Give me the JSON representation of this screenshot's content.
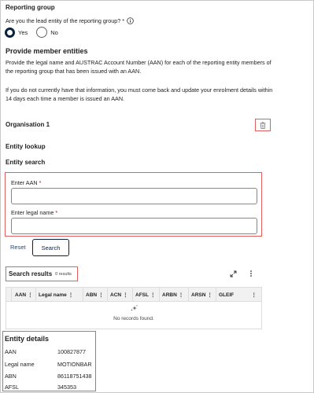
{
  "reporting_group": {
    "title": "Reporting group",
    "question": "Are you the lead entity of the reporting group?",
    "required_mark": "*",
    "info_icon": "info-circle-icon",
    "options": [
      {
        "label": "Yes",
        "selected": true
      },
      {
        "label": "No",
        "selected": false
      }
    ]
  },
  "member_entities": {
    "title": "Provide member entities",
    "para1": "Provide the legal name and AUSTRAC Account Number (AAN) for each of the reporting entity members of the reporting group that has been issued with an AAN.",
    "para2": "If you do not currently have that information, you must come back and update your enrolment details within 14 days each time a member is issued an AAN."
  },
  "organisation": {
    "title": "Organisation 1",
    "delete_icon": "trash-icon"
  },
  "entity_lookup": {
    "title": "Entity lookup",
    "search_title": "Entity search",
    "aan_label": "Enter AAN",
    "aan_value": "",
    "legal_name_label": "Enter legal name",
    "legal_name_value": "",
    "required_mark": "*",
    "reset_label": "Reset",
    "search_label": "Search"
  },
  "search_results": {
    "title": "Search results",
    "count": "0 results",
    "expand_icon": "expand-icon",
    "menu_icon": "more-vertical-icon",
    "columns": [
      "AAN",
      "Legal name",
      "ABN",
      "ACN",
      "AFSL",
      "ARBN",
      "ARSN",
      "GLEIF"
    ],
    "empty_icon": "sparkle-icon",
    "empty_text": "No records found."
  },
  "entity_details": {
    "title": "Entity details",
    "rows": [
      {
        "key": "AAN",
        "value": "100827877"
      },
      {
        "key": "Legal name",
        "value": "MOTIONBAR"
      },
      {
        "key": "ABN",
        "value": "86118751438"
      },
      {
        "key": "AFSL",
        "value": "345353"
      }
    ]
  },
  "colors": {
    "accent": "#0a2240",
    "highlight_border": "#e06060"
  }
}
